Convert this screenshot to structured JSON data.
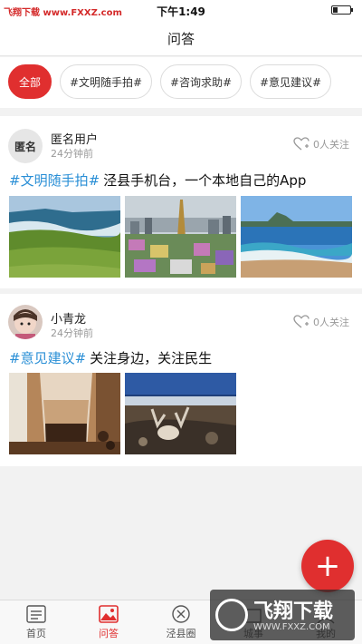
{
  "status_bar": {
    "watermark": "飞翔下载 www.FXXZ.com",
    "time": "下午1:49"
  },
  "header": {
    "title": "问答"
  },
  "filters": [
    {
      "label": "全部",
      "active": true
    },
    {
      "label": "#文明随手拍#",
      "active": false
    },
    {
      "label": "#咨询求助#",
      "active": false
    },
    {
      "label": "#意见建议#",
      "active": false
    }
  ],
  "posts": [
    {
      "avatar_text": "匿名",
      "user": "匿名用户",
      "time": "24分钟前",
      "follow": "0人关注",
      "tag": "#文明随手拍#",
      "question": "泾县手机台，一个本地自己的App",
      "photos": [
        "coast-meadow-photo",
        "city-tower-photo",
        "beach-waves-photo"
      ]
    },
    {
      "avatar_text": "",
      "user": "小青龙",
      "time": "24分钟前",
      "follow": "0人关注",
      "tag": "#意见建议#",
      "question": "关注身边，关注民生",
      "photos": [
        "latte-glass-photo",
        "antler-skull-photo"
      ]
    }
  ],
  "fab": {
    "label": "+"
  },
  "tabbar": [
    {
      "label": "首页",
      "icon": "news-icon",
      "active": false
    },
    {
      "label": "问答",
      "icon": "image-icon",
      "active": true
    },
    {
      "label": "泾县圈",
      "icon": "compass-icon",
      "active": false
    },
    {
      "label": "城事",
      "icon": "city-icon",
      "active": false
    },
    {
      "label": "我的",
      "icon": "user-icon",
      "active": false
    }
  ],
  "watermark_logo": {
    "big": "飞翔下载",
    "small": "WWW.FXXZ.COM"
  },
  "colors": {
    "accent": "#e02f2f",
    "tag": "#2a8fd6"
  }
}
